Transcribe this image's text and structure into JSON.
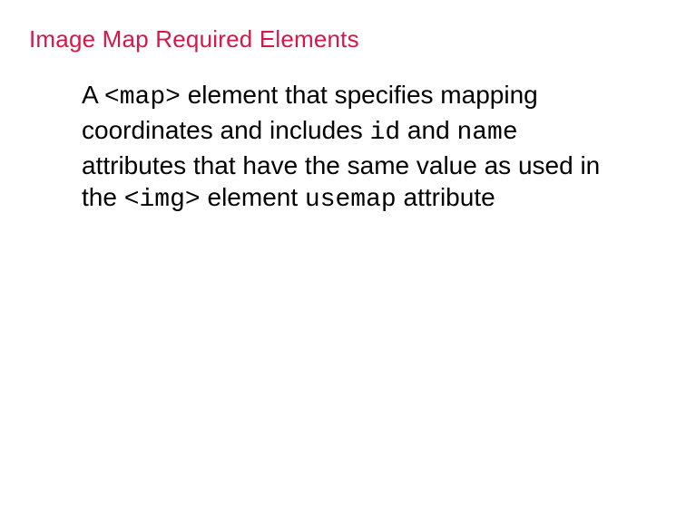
{
  "heading": "Image Map Required Elements",
  "para": {
    "t1": "A ",
    "c1": "<map>",
    "t2": " element that specifies mapping coordinates and includes ",
    "c2": "id",
    "t3": " and ",
    "c3": "name",
    "t4": " attributes that have the same value as used in the ",
    "c4": "<img>",
    "t5": " element ",
    "c5": "usemap",
    "t6": " attribute"
  }
}
